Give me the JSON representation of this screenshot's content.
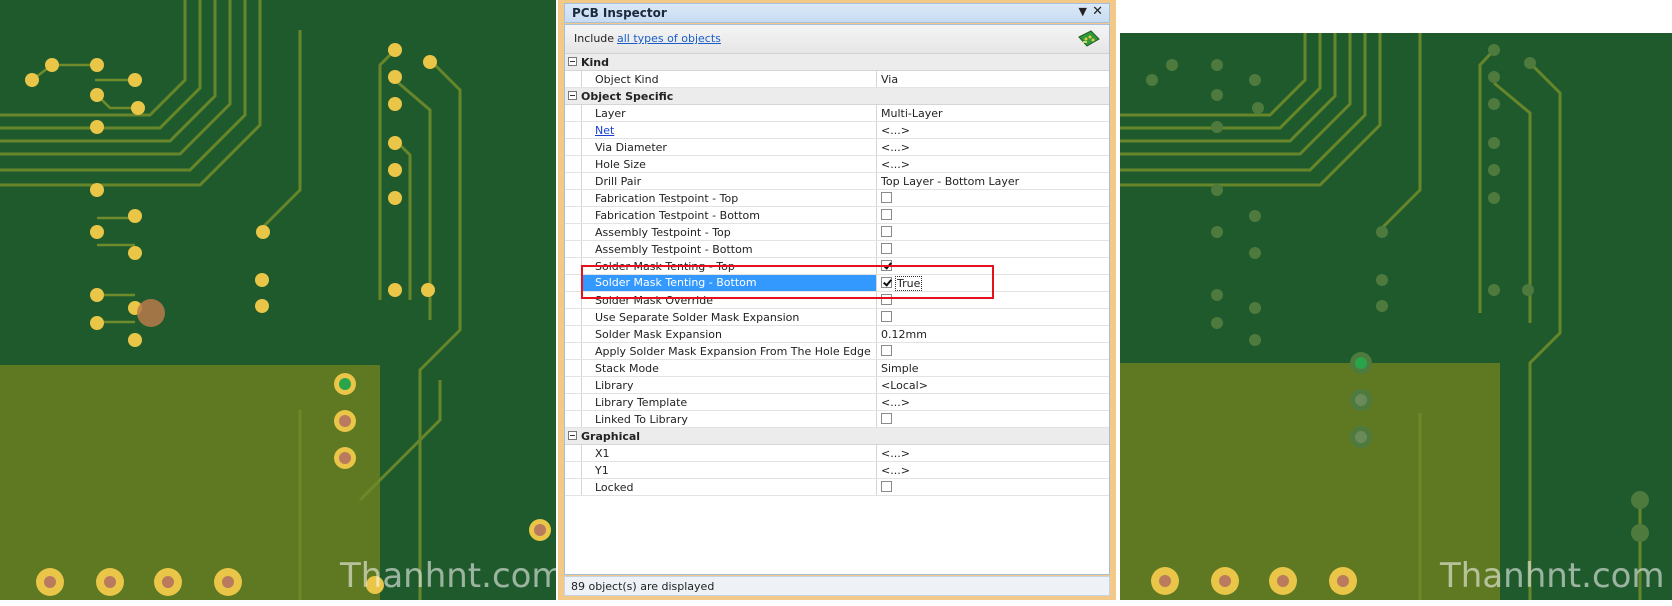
{
  "colors": {
    "pcb_board": "#1f5a2c",
    "pcb_copper": "#6b7f22",
    "pad_gold": "#e9c548",
    "panel_frame": "#f3c98a",
    "selection": "#3399ff",
    "highlight": "#e3121c",
    "link": "#1a5ec7"
  },
  "watermark": "Thanhnt.com",
  "inspector": {
    "title": "PCB Inspector",
    "menu_icon": "triangle-down-icon",
    "close_icon": "close-icon",
    "include_label": "Include",
    "include_link": "all types of objects",
    "include_icon": "pcb-board-icon",
    "categories": [
      {
        "name": "Kind",
        "rows": [
          {
            "name": "Object Kind",
            "value": "Via"
          }
        ]
      },
      {
        "name": "Object Specific",
        "rows": [
          {
            "name": "Layer",
            "value": "Multi-Layer"
          },
          {
            "name": "Net",
            "value": "<...>",
            "link": true
          },
          {
            "name": "Via Diameter",
            "value": "<...>"
          },
          {
            "name": "Hole Size",
            "value": "<...>"
          },
          {
            "name": "Drill Pair",
            "value": "Top Layer - Bottom Layer"
          },
          {
            "name": "Fabrication Testpoint - Top",
            "checkbox": false
          },
          {
            "name": "Fabrication Testpoint - Bottom",
            "checkbox": false
          },
          {
            "name": "Assembly Testpoint - Top",
            "checkbox": false
          },
          {
            "name": "Assembly Testpoint - Bottom",
            "checkbox": false
          },
          {
            "name": "Solder Mask Tenting - Top",
            "checkbox": true
          },
          {
            "name": "Solder Mask Tenting - Bottom",
            "checkbox": true,
            "selected": true,
            "value": "True"
          },
          {
            "name": "Solder Mask Override",
            "checkbox": false
          },
          {
            "name": "Use Separate Solder Mask Expansion",
            "checkbox": false
          },
          {
            "name": "Solder Mask Expansion",
            "value": "0.12mm"
          },
          {
            "name": "Apply Solder Mask Expansion From The Hole Edge",
            "checkbox": false
          },
          {
            "name": "Stack Mode",
            "value": "Simple"
          },
          {
            "name": "Library",
            "value": "<Local>"
          },
          {
            "name": "Library Template",
            "value": "<...>"
          },
          {
            "name": "Linked To Library",
            "checkbox": false
          }
        ]
      },
      {
        "name": "Graphical",
        "rows": [
          {
            "name": "X1",
            "value": "<...>"
          },
          {
            "name": "Y1",
            "value": "<...>"
          },
          {
            "name": "Locked",
            "checkbox": false
          }
        ]
      }
    ],
    "status": "89 object(s) are displayed"
  }
}
